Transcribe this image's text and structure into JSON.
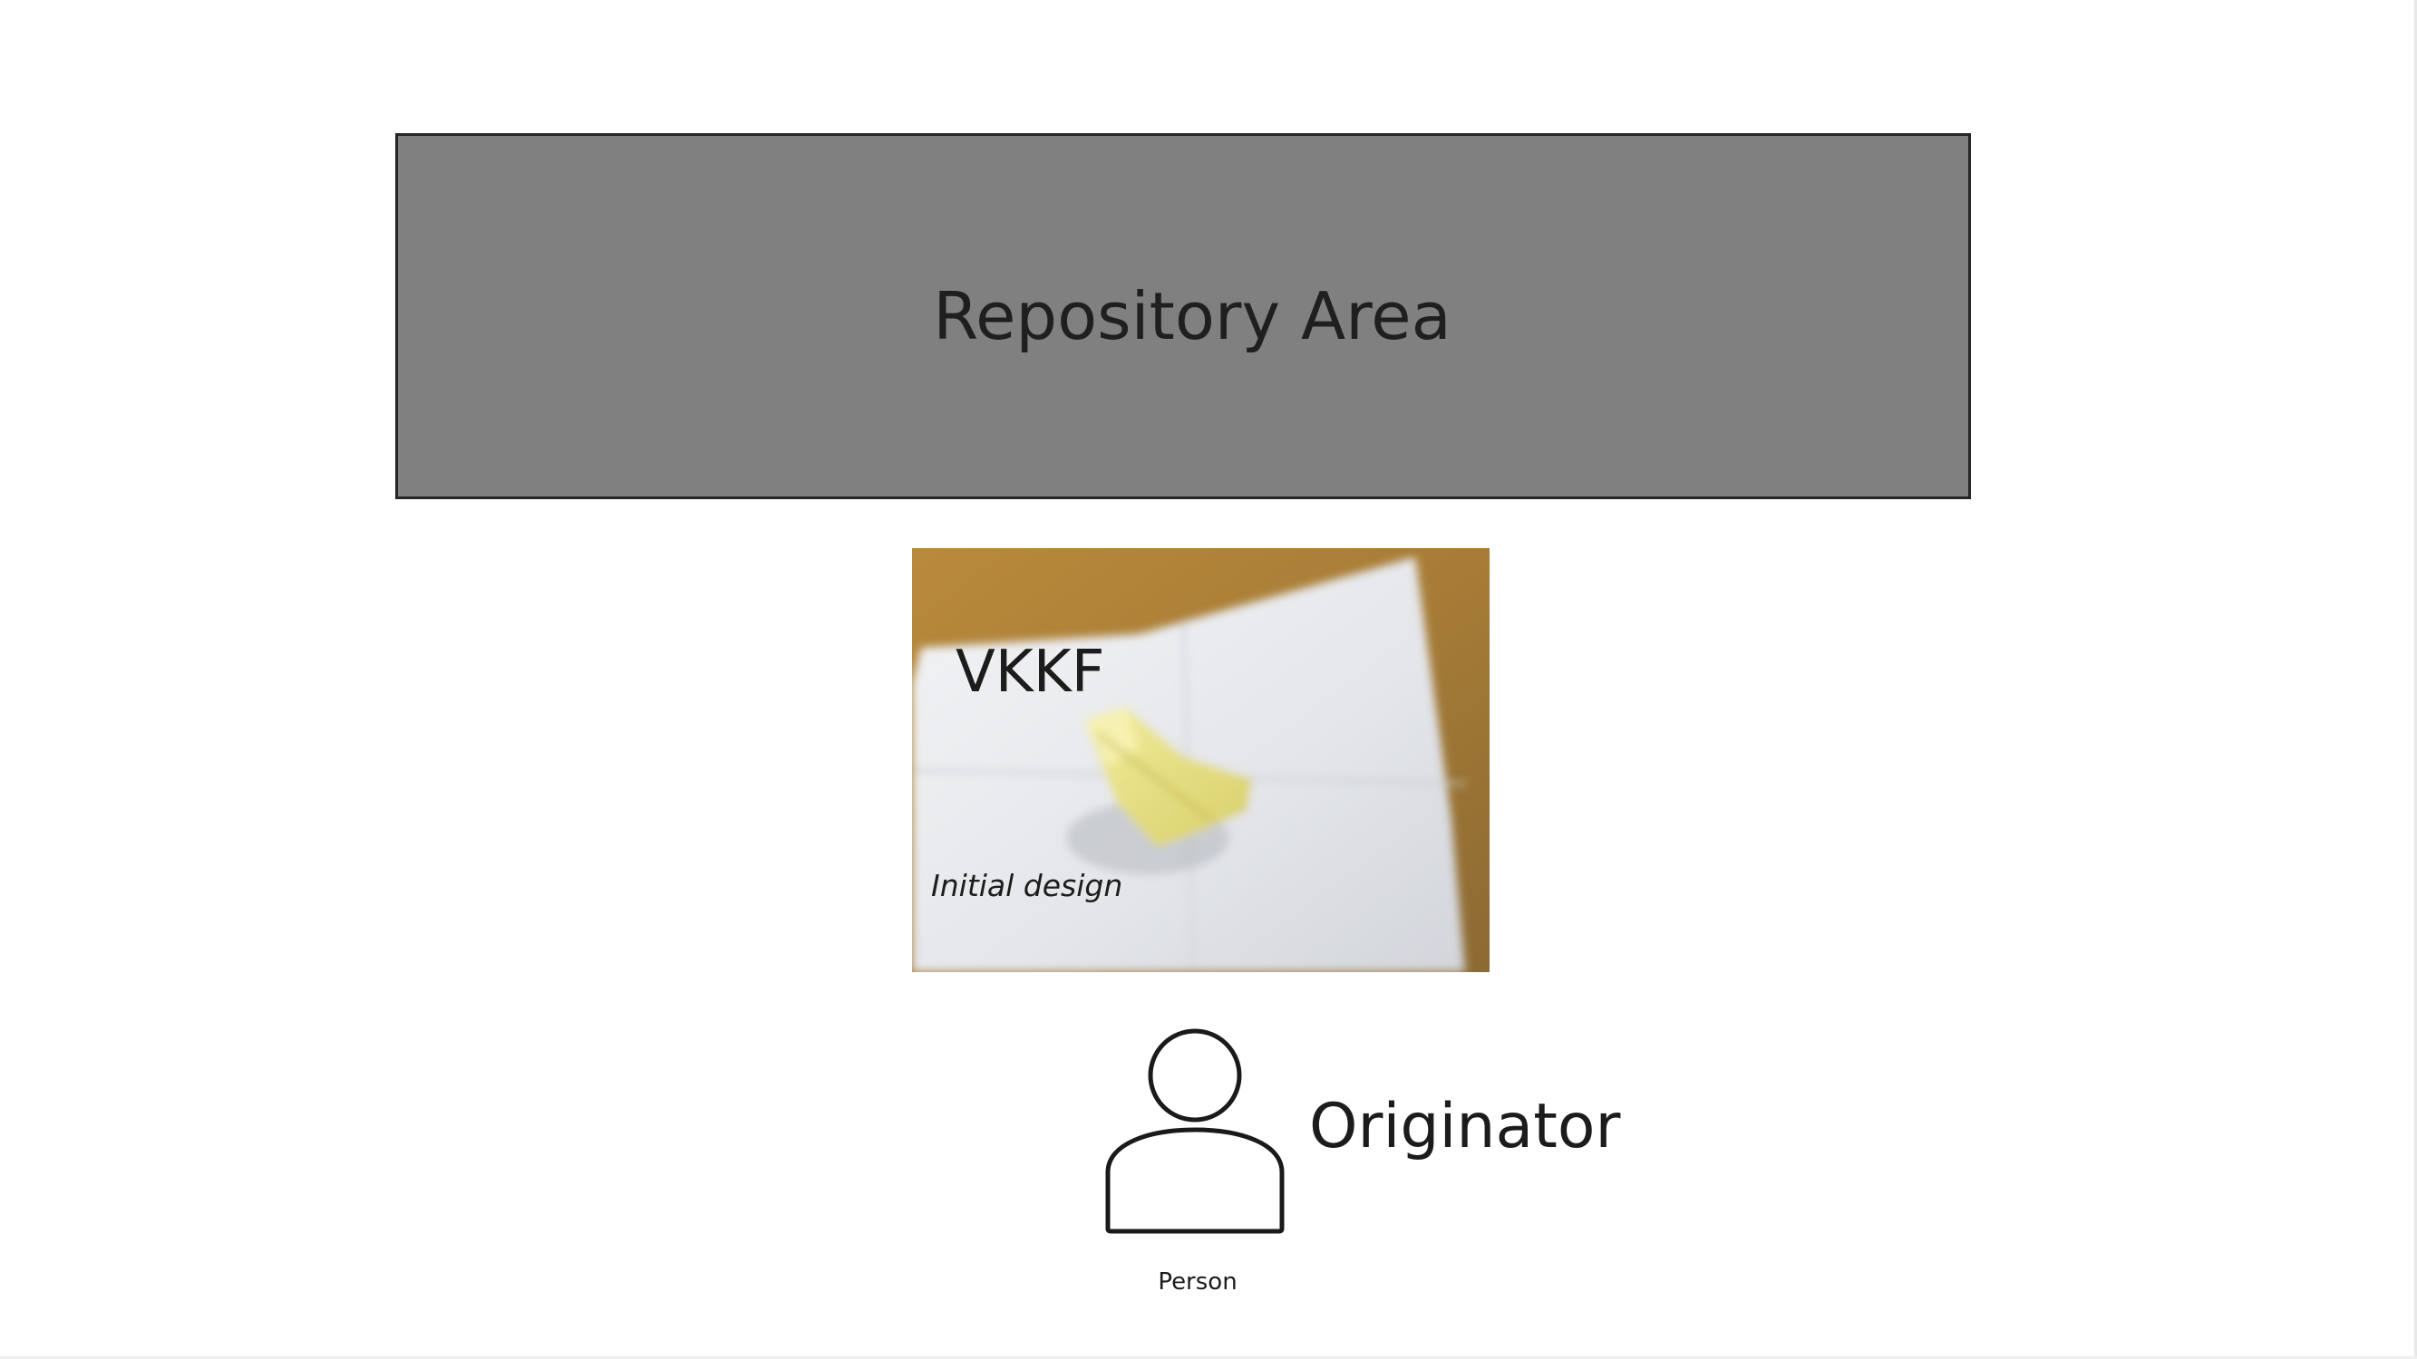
{
  "repository": {
    "label": "Repository Area",
    "fill_color": "#808080",
    "border_color": "#262626"
  },
  "design_card": {
    "title": "VKKF",
    "caption": "Initial design",
    "image": "photo of a folded yellow paper airplane on white paper on a wooden table"
  },
  "actor": {
    "name": "Originator",
    "type_label": "Person",
    "icon": "person-icon"
  }
}
